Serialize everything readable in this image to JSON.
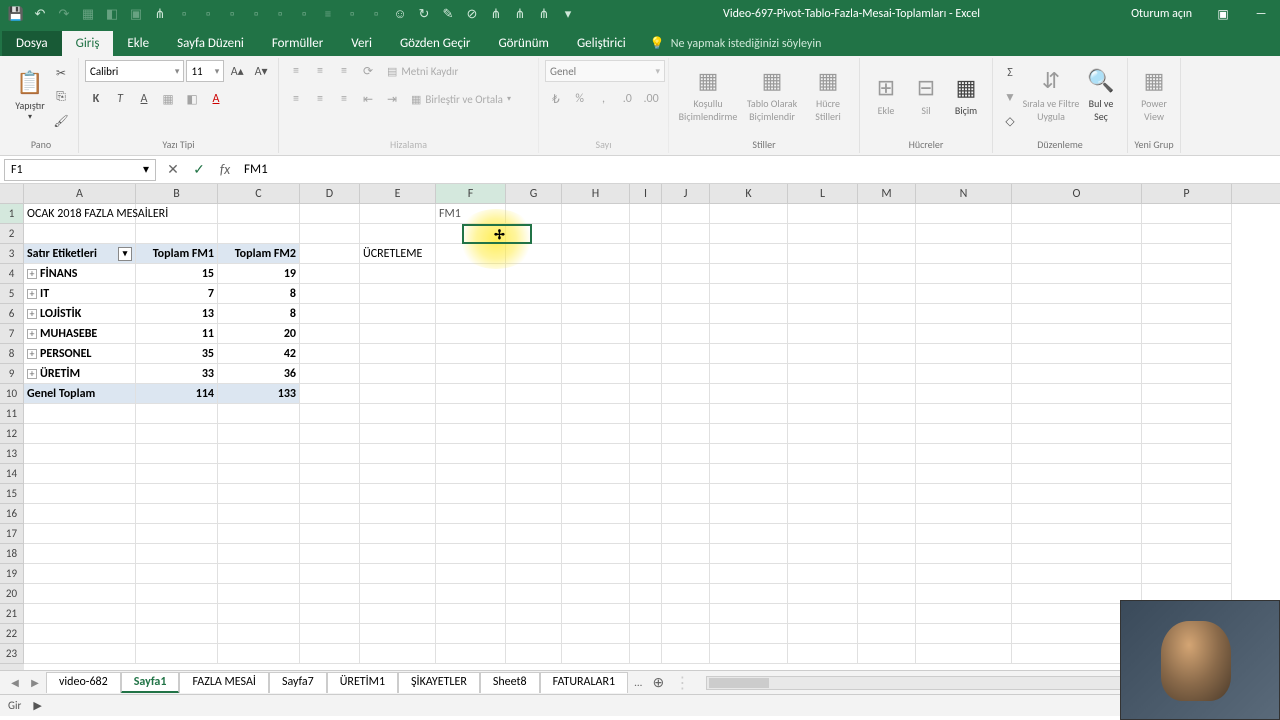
{
  "titlebar": {
    "title": "Video-697-Pivot-Tablo-Fazla-Mesai-Toplamları - Excel",
    "signin": "Oturum açın"
  },
  "ribbon_tabs": {
    "file": "Dosya",
    "home": "Giriş",
    "insert": "Ekle",
    "layout": "Sayfa Düzeni",
    "formulas": "Formüller",
    "data": "Veri",
    "review": "Gözden Geçir",
    "view": "Görünüm",
    "developer": "Geliştirici",
    "tellme": "Ne yapmak istediğinizi söyleyin"
  },
  "ribbon": {
    "paste": "Yapıştır",
    "font_name": "Calibri",
    "font_size": "11",
    "wrap": "Metni Kaydır",
    "merge": "Birleştir ve Ortala",
    "num_format": "Genel",
    "cond": "Koşullu Biçimlendirme",
    "table_fmt": "Tablo Olarak Biçimlendir",
    "cell_styles": "Hücre Stilleri",
    "insert_btn": "Ekle",
    "delete_btn": "Sil",
    "format_btn": "Biçim",
    "sort_filter": "Sırala ve Filtre Uygula",
    "find": "Bul ve Seç",
    "powerview": "Power View",
    "grp_clipboard": "Pano",
    "grp_font": "Yazı Tipi",
    "grp_align": "Hizalama",
    "grp_number": "Sayı",
    "grp_styles": "Stiller",
    "grp_cells": "Hücreler",
    "grp_editing": "Düzenleme",
    "grp_new": "Yeni Grup"
  },
  "formula": {
    "namebox": "F1",
    "formula_value": "FM1"
  },
  "columns": [
    "A",
    "B",
    "C",
    "D",
    "E",
    "F",
    "G",
    "H",
    "I",
    "J",
    "K",
    "L",
    "M",
    "N",
    "O",
    "P"
  ],
  "rows": [
    "1",
    "2",
    "3",
    "4",
    "5",
    "6",
    "7",
    "8",
    "9",
    "10",
    "11",
    "12",
    "13",
    "14",
    "15",
    "16",
    "17",
    "18",
    "19",
    "20",
    "21",
    "22",
    "23"
  ],
  "cells": {
    "A1": "OCAK 2018 FAZLA MESAİLERİ",
    "F1": "FM1",
    "A3": "Satır Etiketleri",
    "B3": "Toplam FM1",
    "C3": "Toplam FM2",
    "E3": "ÜCRETLEME",
    "A4": "FİNANS",
    "B4": "15",
    "C4": "19",
    "A5": "IT",
    "B5": "7",
    "C5": "8",
    "A6": "LOJİSTİK",
    "B6": "13",
    "C6": "8",
    "A7": "MUHASEBE",
    "B7": "11",
    "C7": "20",
    "A8": "PERSONEL",
    "B8": "35",
    "C8": "42",
    "A9": "ÜRETİM",
    "B9": "33",
    "C9": "36",
    "A10": "Genel Toplam",
    "B10": "114",
    "C10": "133"
  },
  "sheets": [
    "video-682",
    "Sayfa1",
    "FAZLA MESAİ",
    "Sayfa7",
    "ÜRETİM1",
    "ŞİKAYETLER",
    "Sheet8",
    "FATURALAR1"
  ],
  "active_sheet": "Sayfa1",
  "sheets_more": "...",
  "status": {
    "mode": "Gir"
  },
  "active_col": "F",
  "active_row": "1"
}
